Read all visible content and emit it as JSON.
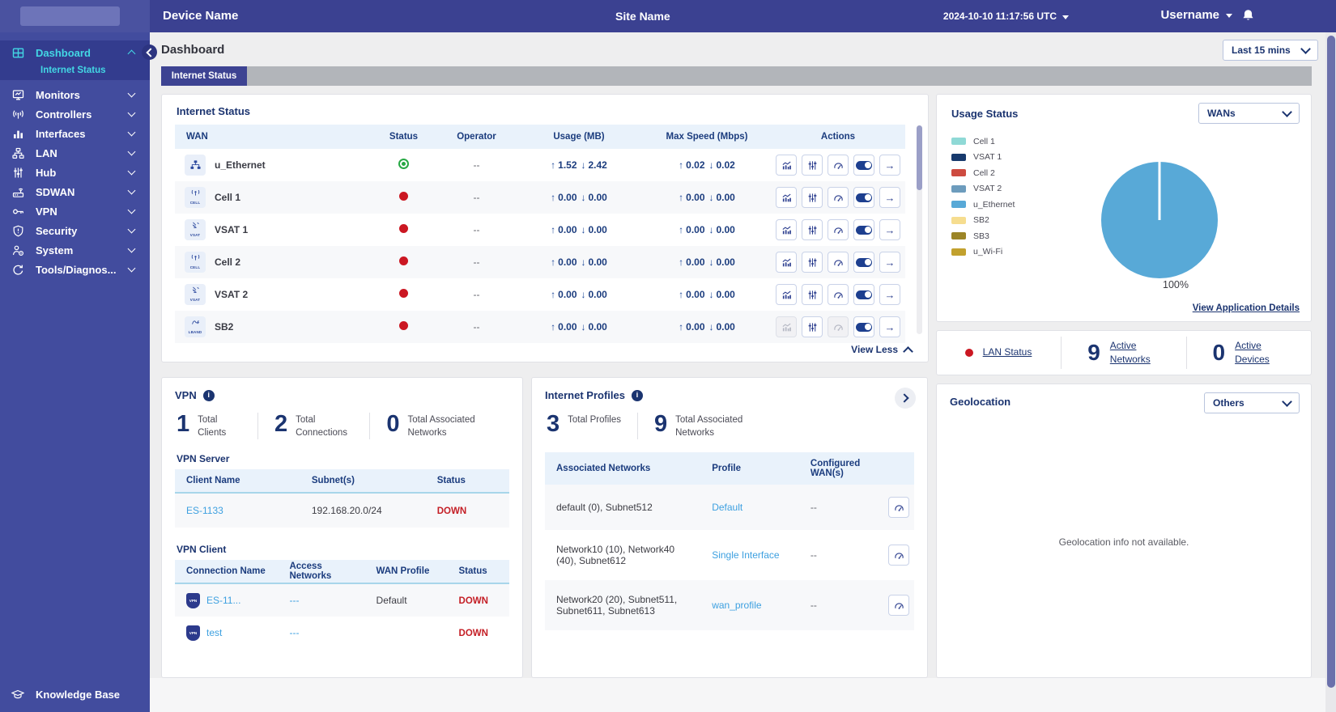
{
  "topbar": {
    "device_name": "Device Name",
    "site_name": "Site Name",
    "datetime": "2024-10-10 11:17:56 UTC",
    "username": "Username"
  },
  "sidebar": {
    "items": [
      "Dashboard",
      "Internet Status",
      "Monitors",
      "Controllers",
      "Interfaces",
      "LAN",
      "Hub",
      "SDWAN",
      "VPN",
      "Security",
      "System",
      "Tools/Diagnos..."
    ],
    "footer": "Knowledge Base"
  },
  "page": {
    "title": "Dashboard",
    "time_range": "Last 15 mins",
    "active_tab": "Internet Status"
  },
  "internet_status": {
    "title": "Internet Status",
    "columns": [
      "WAN",
      "Status",
      "Operator",
      "Usage (MB)",
      "Max Speed (Mbps)",
      "Actions"
    ],
    "rows": [
      {
        "wan": "u_Ethernet",
        "status": "up",
        "operator": "--",
        "usage_up": "1.52",
        "usage_down": "2.42",
        "speed_up": "0.02",
        "speed_down": "0.02"
      },
      {
        "wan": "Cell 1",
        "status": "down",
        "operator": "--",
        "usage_up": "0.00",
        "usage_down": "0.00",
        "speed_up": "0.00",
        "speed_down": "0.00"
      },
      {
        "wan": "VSAT 1",
        "status": "down",
        "operator": "--",
        "usage_up": "0.00",
        "usage_down": "0.00",
        "speed_up": "0.00",
        "speed_down": "0.00"
      },
      {
        "wan": "Cell 2",
        "status": "down",
        "operator": "--",
        "usage_up": "0.00",
        "usage_down": "0.00",
        "speed_up": "0.00",
        "speed_down": "0.00"
      },
      {
        "wan": "VSAT 2",
        "status": "down",
        "operator": "--",
        "usage_up": "0.00",
        "usage_down": "0.00",
        "speed_up": "0.00",
        "speed_down": "0.00"
      },
      {
        "wan": "SB2",
        "status": "down",
        "operator": "--",
        "usage_up": "0.00",
        "usage_down": "0.00",
        "speed_up": "0.00",
        "speed_down": "0.00"
      }
    ],
    "view_less": "View Less"
  },
  "usage_status": {
    "title": "Usage Status",
    "selector": "WANs",
    "legend": [
      {
        "label": "Cell 1",
        "color": "#8fd9d6"
      },
      {
        "label": "VSAT 1",
        "color": "#173a6d"
      },
      {
        "label": "Cell 2",
        "color": "#cd4b40"
      },
      {
        "label": "VSAT 2",
        "color": "#6d9cbd"
      },
      {
        "label": "u_Ethernet",
        "color": "#58a9d7"
      },
      {
        "label": "SB2",
        "color": "#f6dd8f"
      },
      {
        "label": "SB3",
        "color": "#9c8527"
      },
      {
        "label": "u_Wi-Fi",
        "color": "#c2a12e"
      }
    ],
    "link": "View Application Details",
    "chart_data": {
      "type": "pie",
      "slices": [
        {
          "label": "u_Ethernet",
          "value": 100
        }
      ],
      "data_label": "100%",
      "data_label_color": "#f0674d",
      "pie_color": "#58a9d7"
    }
  },
  "lan_summary": {
    "items": [
      {
        "value": "",
        "label": "LAN Status"
      },
      {
        "value": "9",
        "label": "Active Networks"
      },
      {
        "value": "0",
        "label": "Active Devices"
      }
    ]
  },
  "vpn": {
    "title": "VPN",
    "stats": [
      {
        "value": "1",
        "label": "Total Clients"
      },
      {
        "value": "2",
        "label": "Total Connections"
      },
      {
        "value": "0",
        "label": "Total Associated Networks"
      }
    ],
    "server": {
      "title": "VPN Server",
      "columns": [
        "Client Name",
        "Subnet(s)",
        "Status"
      ],
      "rows": [
        {
          "client_name": "ES-1133",
          "subnets": "192.168.20.0/24",
          "status": "DOWN"
        }
      ]
    },
    "client": {
      "title": "VPN Client",
      "columns": [
        "Connection Name",
        "Access Networks",
        "WAN Profile",
        "Status"
      ],
      "rows": [
        {
          "connection_name": "ES-11...",
          "access_networks": "---",
          "wan_profile": "Default",
          "status": "DOWN"
        },
        {
          "connection_name": "test",
          "access_networks": "---",
          "wan_profile": "",
          "status": "DOWN"
        }
      ]
    }
  },
  "internet_profiles": {
    "title": "Internet Profiles",
    "stats": [
      {
        "value": "3",
        "label": "Total Profiles"
      },
      {
        "value": "9",
        "label": "Total Associated Networks"
      }
    ],
    "columns": [
      "Associated Networks",
      "Profile",
      "Configured WAN(s)"
    ],
    "rows": [
      {
        "networks": "default (0), Subnet512",
        "profile": "Default",
        "wans": "--"
      },
      {
        "networks": "Network10 (10), Network40 (40), Subnet612",
        "profile": "Single Interface",
        "wans": "--"
      },
      {
        "networks": "Network20 (20), Subnet511, Subnet611, Subnet613",
        "profile": "wan_profile",
        "wans": "--"
      }
    ]
  },
  "geolocation": {
    "title": "Geolocation",
    "selector": "Others",
    "message": "Geolocation info not available."
  }
}
